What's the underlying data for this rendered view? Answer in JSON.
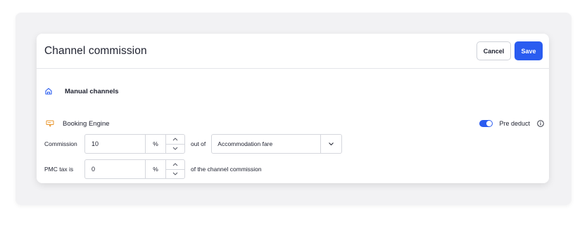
{
  "header": {
    "title": "Channel commission",
    "cancel_label": "Cancel",
    "save_label": "Save"
  },
  "section": {
    "title": "Manual channels",
    "icon": "home-outline-icon"
  },
  "channel": {
    "name": "Booking Engine",
    "icon": "booking-engine-icon",
    "pre_deduct_label": "Pre deduct",
    "pre_deduct_enabled": true
  },
  "commission": {
    "label": "Commission",
    "value": "10",
    "unit": "%",
    "connector": "out of",
    "basis": "Accommodation fare"
  },
  "pmc_tax": {
    "label": "PMC tax is",
    "value": "0",
    "unit": "%",
    "suffix": "of the channel commission"
  },
  "colors": {
    "accent": "#2a5cf0",
    "channel_icon": "#e8942a",
    "section_icon": "#2a5cf0"
  }
}
